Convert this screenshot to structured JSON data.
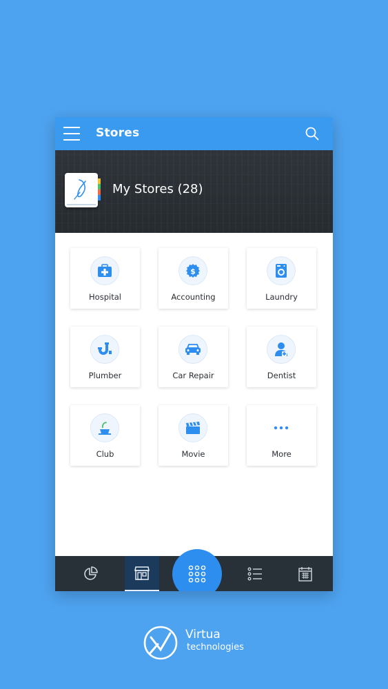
{
  "header": {
    "title": "Stores"
  },
  "banner": {
    "title": "My Stores (28)"
  },
  "categories": [
    {
      "label": "Hospital",
      "icon": "hospital-icon"
    },
    {
      "label": "Accounting",
      "icon": "dollar-icon"
    },
    {
      "label": "Laundry",
      "icon": "washing-machine-icon"
    },
    {
      "label": "Plumber",
      "icon": "pipe-icon"
    },
    {
      "label": "Car Repair",
      "icon": "car-icon"
    },
    {
      "label": "Dentist",
      "icon": "dentist-icon"
    },
    {
      "label": "Club",
      "icon": "cocktail-icon"
    },
    {
      "label": "Movie",
      "icon": "clapperboard-icon"
    },
    {
      "label": "More",
      "icon": "more-dots-icon"
    }
  ],
  "bottom_nav": [
    {
      "icon": "pie-chart-icon",
      "active": false
    },
    {
      "icon": "store-icon",
      "active": true
    },
    {
      "icon": "apps-grid-icon",
      "active": false
    },
    {
      "icon": "list-icon",
      "active": false
    },
    {
      "icon": "calendar-icon",
      "active": false
    }
  ],
  "brand": {
    "name": "Virtua",
    "tagline": "technologies"
  },
  "colors": {
    "accent": "#3a9aef",
    "background": "#4ea3f0",
    "bottom_bar": "#283038",
    "icon_blue": "#2e8ef0"
  }
}
